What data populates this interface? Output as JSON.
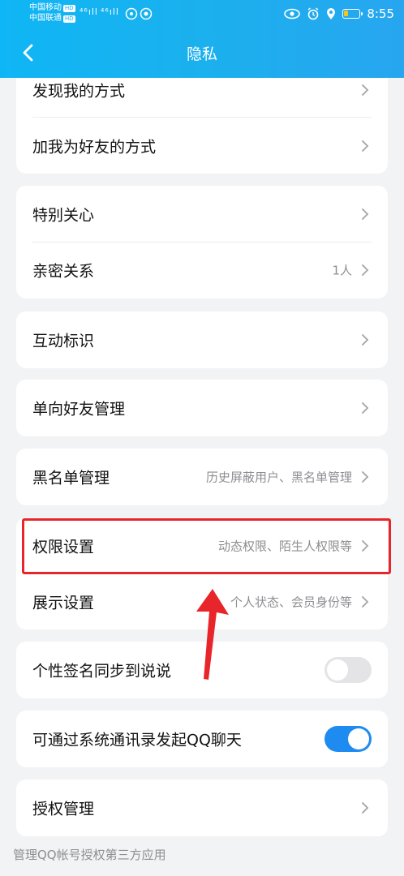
{
  "status_bar": {
    "carrier1": "中国移动",
    "carrier2": "中国联通",
    "hd": "HD",
    "signal1": "⁴⁶ıll",
    "signal2": "⁴⁶ıll",
    "time": "8:55",
    "icons": [
      "wifi-hotspot-icon",
      "eye-icon",
      "alarm-icon",
      "location-icon",
      "battery-icon"
    ]
  },
  "header": {
    "title": "隐私",
    "back_icon": "chevron-left-icon"
  },
  "sections": {
    "find_me": "发现我的方式",
    "add_friend": "加我为好友的方式",
    "special_care": "特别关心",
    "intimate": "亲密关系",
    "intimate_value": "1人",
    "interaction_mark": "互动标识",
    "one_way_friend": "单向好友管理",
    "blacklist": "黑名单管理",
    "blacklist_value": "历史屏蔽用户、黑名单管理",
    "permissions": "权限设置",
    "permissions_value": "动态权限、陌生人权限等",
    "display": "展示设置",
    "display_value": "个人状态、会员身份等",
    "signature_sync": "个性签名同步到说说",
    "signature_sync_on": false,
    "contacts_chat": "可通过系统通讯录发起QQ聊天",
    "contacts_chat_on": true,
    "auth_manage": "授权管理",
    "auth_footnote": "管理QQ帐号授权第三方应用"
  },
  "colors": {
    "header": "#1bb0ee",
    "toggle_on": "#1e8bf0",
    "highlight": "#e8252a"
  }
}
